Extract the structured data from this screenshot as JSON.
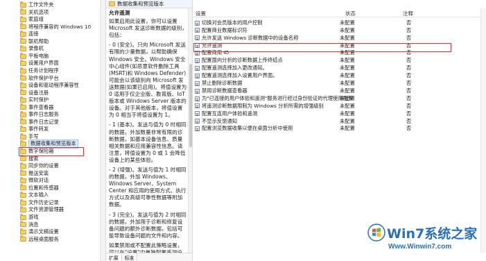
{
  "tree": {
    "items": [
      {
        "label": "工作文件夹"
      },
      {
        "label": "关机选项"
      },
      {
        "label": "家庭组"
      },
      {
        "label": "将程序兼容的 Windows 10"
      },
      {
        "label": "连接"
      },
      {
        "label": "联机帮助"
      },
      {
        "label": "录像机"
      },
      {
        "label": "平板电脑"
      },
      {
        "label": "设置用户界面"
      },
      {
        "label": "任务计划程序"
      },
      {
        "label": "软件保护平台"
      },
      {
        "label": "设备和驱动程序兼容性"
      },
      {
        "label": "设备注册"
      },
      {
        "label": "实时保护"
      },
      {
        "label": "事件查看器"
      },
      {
        "label": "事件日志服务"
      },
      {
        "label": "事件日志记录"
      },
      {
        "label": "事件转发"
      },
      {
        "label": "手写"
      },
      {
        "label": "数据收集和预览版本",
        "selected": true
      },
      {
        "label": "数字保险箱"
      },
      {
        "label": "搜索"
      },
      {
        "label": "同步你的设置"
      },
      {
        "label": "推送安装"
      },
      {
        "label": "微软对话"
      },
      {
        "label": "位置和传感器"
      },
      {
        "label": "文本输入"
      },
      {
        "label": "文件历史记录"
      },
      {
        "label": "文件资源管理器"
      },
      {
        "label": "游戏"
      },
      {
        "label": "消息"
      },
      {
        "label": "演示文稿设置"
      },
      {
        "label": "远程桌面服务"
      }
    ]
  },
  "description": {
    "header_title": "数据收集和预览版本",
    "policy_title": "允许遥测",
    "paragraphs": [
      "如果启用此设置，你可以设置 Microsoft 发送诊断数据的级别，包括：",
      "- 0 (安全)。只向 Microsoft 发送有限的少量数据，以帮助确保 Windows 安全。Windows 安全中心组件(如恶意软件删除工具(MSRT)和 Windows Defender)可能会以该级别向 Microsoft 发送数据(如果已启用)。将值设置为 0 适用于仅企业版、教育版、IoT 版本或 Windows Server 版本的设备。对于其他版本，将值设置为 0 相当于将值设置为 1。",
      "- 1 (基本)。发送与值为 0 时相同的数据，外加数量非常有限的诊断数据，如基本设备信息、质量相关数据和应用兼容性信息。请注意，将值设置为 0 或 1 会降低设备上的某些体验。",
      "- 2 (增强)。发送与值为 1 时相同的数据，外加 Windows、Windows Server、System Center 和应用的使用方式、执行方式以及高级可靠性数据等附加数据。",
      "- 3 (完全)。发送与值为 2 时相同的数据，外加用于诊断和修复设备问题的额外诊断数据，包括可能导致设备问题的文件和内容。",
      "如果禁用或不配置此策略设置，可以在\"设置\"中单独配置遥测设置。"
    ],
    "tabs": [
      "扩展",
      "标准"
    ]
  },
  "settings": {
    "columns": {
      "setting": "设置",
      "state": "状态",
      "comment": "注释"
    },
    "rows": [
      {
        "name": "切换对会员版本的用户控制",
        "state": "未配置",
        "comment": "否"
      },
      {
        "name": "配置商业数据标识符",
        "state": "未配置",
        "comment": "否"
      },
      {
        "name": "允许发送 Windows 诊断数据中的设备名称",
        "state": "未配置",
        "comment": "否"
      },
      {
        "name": "允许遥测",
        "state": "未配置",
        "comment": "否",
        "highlight": true
      },
      {
        "name": "配置商用 ID",
        "state": "未配置",
        "comment": "否"
      },
      {
        "name": "配置面向分析的诊断数据上传终结点",
        "state": "未配置",
        "comment": "否"
      },
      {
        "name": "配置遥测选择加入更改通知。",
        "state": "未配置",
        "comment": "否"
      },
      {
        "name": "配置遥测选择加入设置用户界面。",
        "state": "未配置",
        "comment": "否"
      },
      {
        "name": "禁止删除诊断数据",
        "state": "未配置",
        "comment": "否"
      },
      {
        "name": "禁用诊断数据查看器",
        "state": "未配置",
        "comment": "否"
      },
      {
        "name": "为\"已连接的用户体验和遥测\"服务进行经过身份验证的代理使用配置",
        "state": "未配置",
        "comment": "否"
      },
      {
        "name": "将遥测诊断数据限制为 Windows 分析所需的增强级别",
        "state": "未配置",
        "comment": "否"
      },
      {
        "name": "配置互连用户体验和遥测",
        "state": "未配置",
        "comment": "否"
      },
      {
        "name": "不显示反馈通知",
        "state": "未配置",
        "comment": "否"
      },
      {
        "name": "配置浏览数据收集以便在桌面分析中使用",
        "state": "未配置",
        "comment": "否"
      }
    ]
  },
  "watermark": {
    "title": "Win7系统之家",
    "url": "Www.Winwin7.com"
  }
}
